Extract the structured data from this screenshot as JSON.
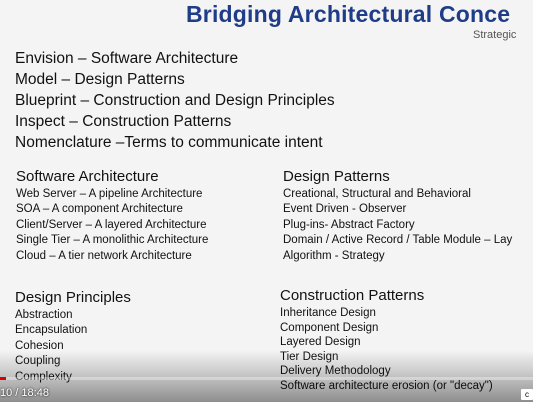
{
  "slide": {
    "title": "Bridging Architectural Conce",
    "subtitle": "Strategic",
    "intro": [
      "Envision – Software Architecture",
      "Model – Design Patterns",
      "Blueprint – Construction and Design Principles",
      "Inspect – Construction Patterns",
      "Nomenclature –Terms to communicate intent"
    ],
    "software_architecture": {
      "heading": "Software Architecture",
      "items": [
        "Web Server – A pipeline Architecture",
        "SOA – A component Architecture",
        "Client/Server – A layered Architecture",
        "Single Tier – A monolithic Architecture",
        "Cloud – A tier network Architecture"
      ]
    },
    "design_patterns": {
      "heading": "Design Patterns",
      "items": [
        "Creational, Structural and Behavioral",
        "Event Driven - Observer",
        "Plug-ins- Abstract Factory",
        "Domain / Active Record / Table Module – Lay",
        "Algorithm - Strategy"
      ]
    },
    "design_principles": {
      "heading": "Design Principles",
      "items": [
        "Abstraction",
        "Encapsulation",
        "Cohesion",
        "Coupling",
        "Complexity"
      ]
    },
    "construction_patterns": {
      "heading": "Construction Patterns",
      "items": [
        "Inheritance Design",
        "Component Design",
        "Layered Design",
        "Tier Design",
        "Delivery Methodology",
        "Software architecture erosion (or \"decay\")"
      ]
    }
  },
  "player": {
    "time_display": "10 / 18:48",
    "progress_fraction": 0.009,
    "cc_label": "c",
    "progress_color": "#e00000"
  }
}
